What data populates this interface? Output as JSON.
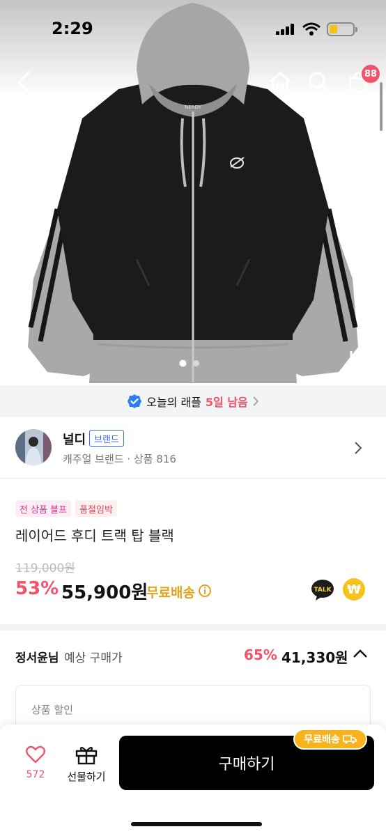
{
  "status_bar": {
    "time": "2:29",
    "battery_level": 0.35
  },
  "nav": {
    "cart_count": "88",
    "icons": [
      "back-icon",
      "home-icon",
      "search-icon",
      "cart-icon"
    ]
  },
  "gallery": {
    "slide_count": 2,
    "active_slide": 1,
    "garment_print": "NERDY"
  },
  "raffle": {
    "text": "오늘의 래플",
    "remaining": "5일 남음"
  },
  "brand": {
    "name": "널디",
    "badge": "브랜드",
    "subtitle": "캐주얼 브랜드 · 상품 816"
  },
  "product": {
    "tags": [
      {
        "label": "전 상품 블프",
        "style": "pink"
      },
      {
        "label": "품절임박",
        "style": "red"
      }
    ],
    "title": "레이어드 후디 트랙 탑 블랙",
    "original_price": "119,000원",
    "discount_rate": "53%",
    "sale_price": "55,900원",
    "shipping": "무료배송",
    "talk_label": "TALK",
    "pay_symbol": "₩"
  },
  "expected": {
    "user": "정서윤님",
    "label": "예상 구매가",
    "discount_rate": "65%",
    "price": "41,330원",
    "box_title": "상품 할인"
  },
  "bottom_bar": {
    "like_count": "572",
    "gift_label": "선물하기",
    "buy_label": "구매하기",
    "shipping_pill": "무료배송"
  },
  "colors": {
    "accent": "#f2526a",
    "brand_blue": "#3d67f5",
    "shipping_yellow": "#e0a31a",
    "pay_yellow": "#f7c21a"
  }
}
